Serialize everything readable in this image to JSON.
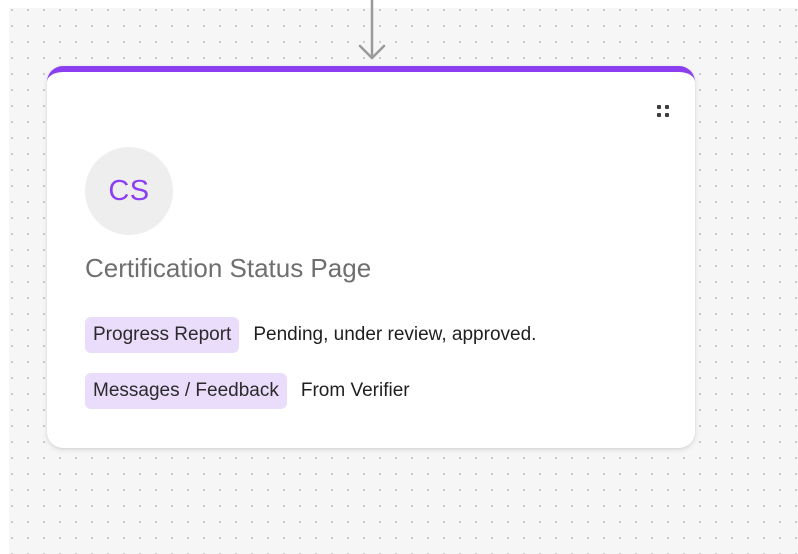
{
  "card": {
    "accent_color": "#8b3ff0",
    "avatar_initials": "CS",
    "title": "Certification Status Page",
    "drag_handle_icon": "drag-dots-icon",
    "rows": [
      {
        "tag": "Progress Report",
        "value": "Pending, under review, approved.",
        "tag_color": "#eadcfb"
      },
      {
        "tag": "Messages / Feedback",
        "value": "From Verifier",
        "tag_color": "#eadcfb"
      }
    ]
  },
  "connector": {
    "icon": "arrow-down-icon"
  }
}
